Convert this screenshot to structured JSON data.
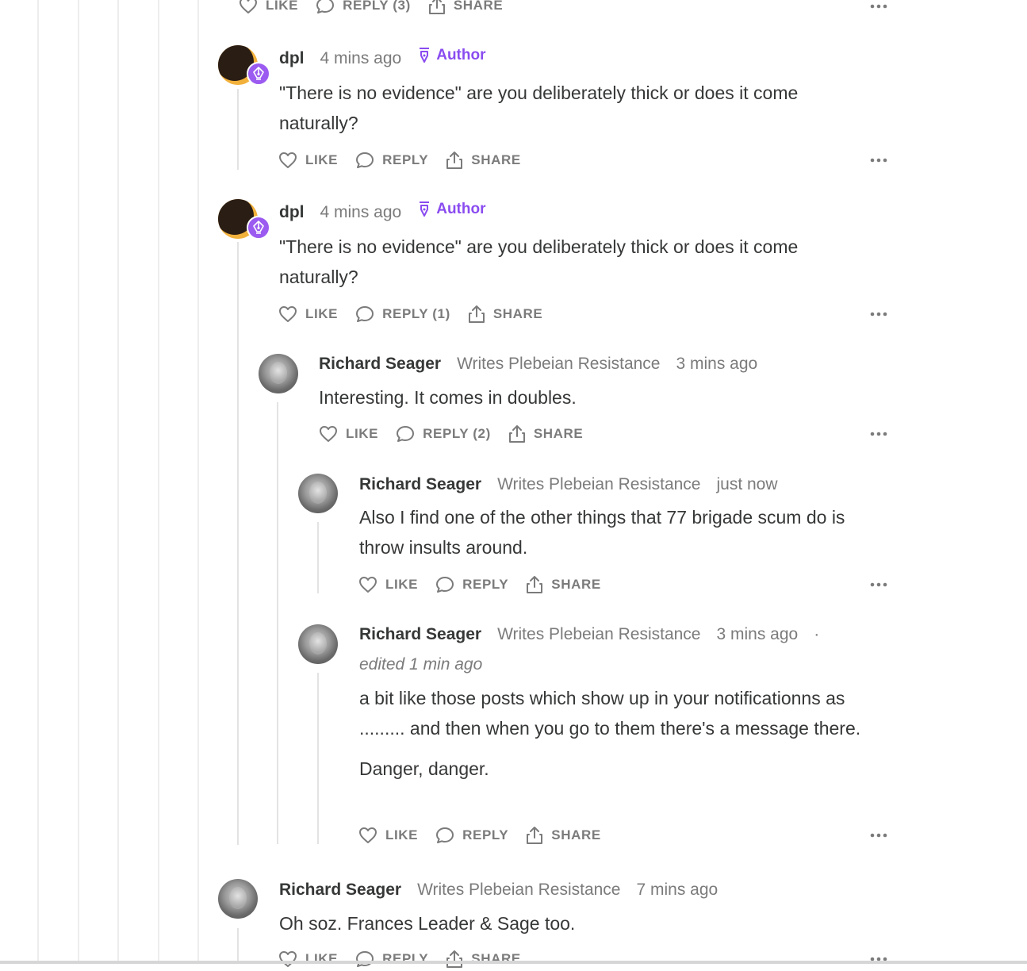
{
  "colors": {
    "accent": "#8a4cf0",
    "text": "#363737",
    "muted": "#7b7b7b"
  },
  "actions": {
    "like": "LIKE",
    "share": "SHARE",
    "reply": "REPLY"
  },
  "top_partial": {
    "reply": "REPLY (3)"
  },
  "comments": [
    {
      "name": "dpl",
      "time": "4 mins ago",
      "badge": "Author",
      "body": "\"There is no evidence\" are you deliberately thick or does it come naturally?",
      "reply": "REPLY"
    },
    {
      "name": "dpl",
      "time": "4 mins ago",
      "badge": "Author",
      "body": "\"There is no evidence\" are you deliberately thick or does it come naturally?",
      "reply": "REPLY (1)"
    },
    {
      "name": "Richard Seager",
      "writes": "Writes Plebeian Resistance",
      "time": "3 mins ago",
      "body": "Interesting. It comes in doubles.",
      "reply": "REPLY (2)"
    },
    {
      "name": "Richard Seager",
      "writes": "Writes Plebeian Resistance",
      "time": "just now",
      "body": "Also I find one of the other things that 77 brigade scum do is throw insults around.",
      "reply": "REPLY"
    },
    {
      "name": "Richard Seager",
      "writes": "Writes Plebeian Resistance",
      "time": "3 mins ago",
      "separator": "·",
      "edited": "edited 1 min ago",
      "body": "a bit like those posts which show up in your notificationns as ......... and then when you go to them there's a message there.",
      "body2": "Danger, danger.",
      "reply": "REPLY"
    },
    {
      "name": "Richard Seager",
      "writes": "Writes Plebeian Resistance",
      "time": "7 mins ago",
      "body": "Oh soz. Frances Leader & Sage too.",
      "reply": "REPLY"
    }
  ]
}
